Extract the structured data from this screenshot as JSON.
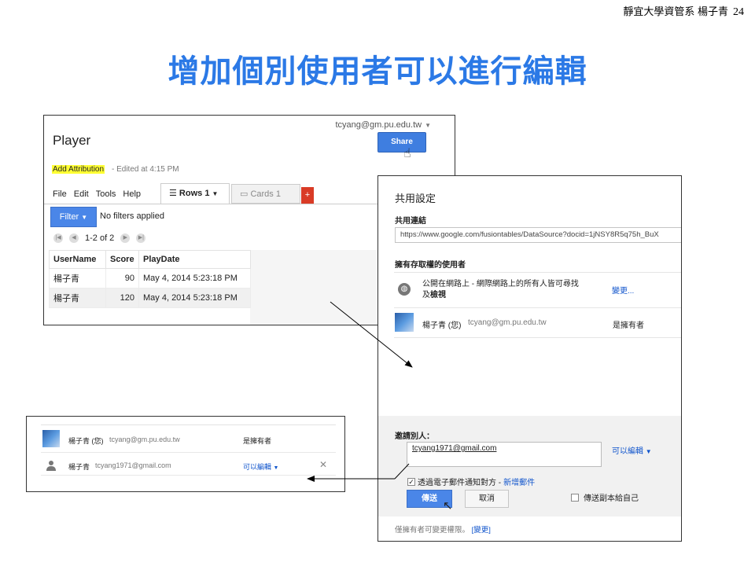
{
  "slide": {
    "header_text": "靜宜大學資管系 楊子青",
    "page_number": "24",
    "title": "增加個別使用者可以進行編輯",
    "title_color": "#2b79e6"
  },
  "player_window": {
    "account": "tcyang@gm.pu.edu.tw",
    "table_name": "Player",
    "share_label": "Share",
    "attribution": "Add Attribution",
    "edited": "-   Edited at 4:15 PM",
    "menu": [
      "File",
      "Edit",
      "Tools",
      "Help"
    ],
    "tabs": [
      {
        "label": "Rows 1",
        "active": true
      },
      {
        "label": "Cards 1",
        "active": false
      }
    ],
    "add_tab_label": "+",
    "filter_label": "Filter",
    "no_filters": "No filters applied",
    "pager_range": "1-2 of 2",
    "columns": [
      "UserName",
      "Score",
      "PlayDate"
    ],
    "rows": [
      [
        "楊子青",
        "90",
        "May 4, 2014 5:23:18 PM"
      ],
      [
        "楊子青",
        "120",
        "May 4, 2014 5:23:18 PM"
      ]
    ]
  },
  "share_settings": {
    "title": "共用設定",
    "link_label": "共用連結",
    "link_url": "https://www.google.com/fusiontables/DataSource?docid=1jNSY8R5q75h_BuX",
    "who_has_access": "擁有存取權的使用者",
    "public_text_line1": "公開在網路上 - 網際網路上的所有人皆可尋找",
    "public_text_prefix": "及",
    "public_text_bold": "檢視",
    "change_link": "變更...",
    "owner_name": "楊子青 (您)",
    "owner_email": "tcyang@gm.pu.edu.tw",
    "owner_role": "是擁有者",
    "invite_label": "邀請別人：",
    "invite_value": "tcyang1971@gmail.com",
    "invite_permission": "可以編輯",
    "notify_text": "透過電子郵件通知對方 -",
    "notify_link": "新增郵件",
    "send_label": "傳送",
    "cancel_label": "取消",
    "copy_self_label": "傳送副本給自己",
    "footnote_prefix": "僅擁有者可變更權限。",
    "footnote_link": "[變更]"
  },
  "result_list": {
    "owner_name": "楊子青 (您)",
    "owner_email": "tcyang@gm.pu.edu.tw",
    "owner_role": "是擁有者",
    "editor_name": "楊子青",
    "editor_email": "tcyang1971@gmail.com",
    "editor_permission": "可以編輯",
    "remove_label": "✕"
  },
  "colors": {
    "button_blue": "#4a86e8",
    "link_blue": "#1155cc",
    "highlight_yellow": "#ffff33",
    "add_tab_red": "#d93b26"
  }
}
